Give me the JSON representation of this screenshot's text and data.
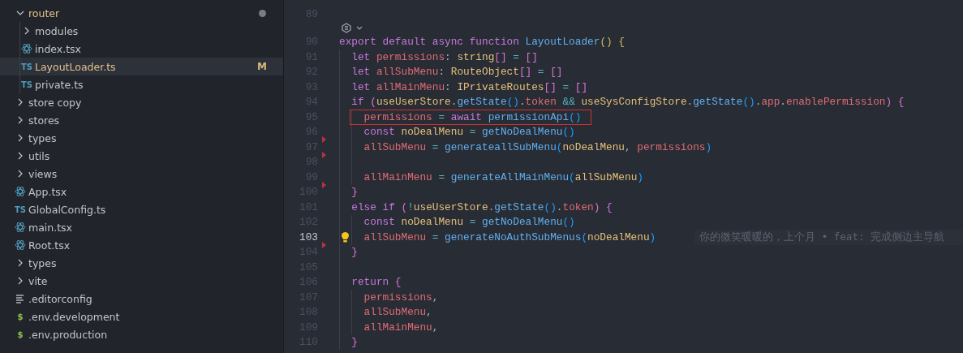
{
  "explorer": {
    "items": [
      {
        "kind": "cut-off",
        "children": [
          {
            "kind": "folder",
            "label": "router",
            "expanded": true,
            "modified": true,
            "selected": false,
            "children": [
              {
                "kind": "folder",
                "label": "modules",
                "expanded": false,
                "modified": false,
                "selected": false
              },
              {
                "kind": "react",
                "label": "index.tsx",
                "modified": false,
                "selected": false
              },
              {
                "kind": "ts",
                "icon": "TS",
                "label": "LayoutLoader.ts",
                "modified": true,
                "badge": "M",
                "selected": true
              },
              {
                "kind": "ts",
                "icon": "TS",
                "label": "private.ts",
                "modified": false,
                "selected": false
              }
            ]
          },
          {
            "kind": "folder",
            "label": "store copy",
            "expanded": false,
            "modified": false,
            "selected": false
          },
          {
            "kind": "folder",
            "label": "stores",
            "expanded": false,
            "modified": false,
            "selected": false
          },
          {
            "kind": "folder",
            "label": "types",
            "expanded": false,
            "modified": false,
            "selected": false
          },
          {
            "kind": "folder",
            "label": "utils",
            "expanded": false,
            "modified": false,
            "selected": false
          },
          {
            "kind": "folder",
            "label": "views",
            "expanded": false,
            "modified": false,
            "selected": false
          },
          {
            "kind": "react",
            "label": "App.tsx",
            "modified": false,
            "selected": false
          },
          {
            "kind": "ts",
            "icon": "TS",
            "label": "GlobalConfig.ts",
            "modified": false,
            "selected": false
          },
          {
            "kind": "react",
            "label": "main.tsx",
            "modified": false,
            "selected": false
          },
          {
            "kind": "react",
            "label": "Root.tsx",
            "modified": false,
            "selected": false
          }
        ]
      },
      {
        "kind": "folder",
        "label": "types",
        "expanded": false,
        "modified": false,
        "selected": false
      },
      {
        "kind": "folder",
        "label": "vite",
        "expanded": false,
        "modified": false,
        "selected": false
      },
      {
        "kind": "config",
        "label": ".editorconfig",
        "modified": false,
        "selected": false
      },
      {
        "kind": "env",
        "icon": "$",
        "label": ".env.development",
        "modified": false,
        "selected": false
      },
      {
        "kind": "env",
        "icon": "$",
        "label": ".env.production",
        "modified": false,
        "selected": false
      }
    ]
  },
  "editor": {
    "lines": [
      {
        "number": "89",
        "current": false
      },
      {
        "number": "90",
        "current": false,
        "code_lens": true,
        "tokens": [
          {
            "text": "export default async function ",
            "kind": "kw"
          },
          {
            "text": "LayoutLoader",
            "kind": "fn"
          },
          {
            "text": "() {",
            "kind": "b1"
          }
        ],
        "children": [
          {
            "number": "91",
            "current": false,
            "tokens": [
              {
                "text": "let ",
                "kind": "kw"
              },
              {
                "text": "permissions",
                "kind": "var"
              },
              {
                "text": ": ",
                "kind": "p"
              },
              {
                "text": "string",
                "kind": "ident"
              },
              {
                "text": "[]",
                "kind": "b2"
              },
              {
                "text": " = ",
                "kind": "op"
              },
              {
                "text": "[]",
                "kind": "b2"
              }
            ]
          },
          {
            "number": "92",
            "current": false,
            "tokens": [
              {
                "text": "let ",
                "kind": "kw"
              },
              {
                "text": "allSubMenu",
                "kind": "var"
              },
              {
                "text": ": ",
                "kind": "p"
              },
              {
                "text": "RouteObject",
                "kind": "ident"
              },
              {
                "text": "[]",
                "kind": "b2"
              },
              {
                "text": " = ",
                "kind": "op"
              },
              {
                "text": "[]",
                "kind": "b2"
              }
            ]
          },
          {
            "number": "93",
            "current": false,
            "tokens": [
              {
                "text": "let ",
                "kind": "kw"
              },
              {
                "text": "allMainMenu",
                "kind": "var"
              },
              {
                "text": ": ",
                "kind": "p"
              },
              {
                "text": "IPrivateRoutes",
                "kind": "ident"
              },
              {
                "text": "[]",
                "kind": "b2"
              },
              {
                "text": " = ",
                "kind": "op"
              },
              {
                "text": "[]",
                "kind": "b2"
              }
            ]
          },
          {
            "number": "94",
            "current": false,
            "tokens": [
              {
                "text": "if ",
                "kind": "kw"
              },
              {
                "text": "(",
                "kind": "b2"
              },
              {
                "text": "useUserStore",
                "kind": "ident"
              },
              {
                "text": ".",
                "kind": "p"
              },
              {
                "text": "getState",
                "kind": "fn"
              },
              {
                "text": "()",
                "kind": "b3"
              },
              {
                "text": ".",
                "kind": "p"
              },
              {
                "text": "token",
                "kind": "prop"
              },
              {
                "text": " && ",
                "kind": "op"
              },
              {
                "text": "useSysConfigStore",
                "kind": "ident"
              },
              {
                "text": ".",
                "kind": "p"
              },
              {
                "text": "getState",
                "kind": "fn"
              },
              {
                "text": "()",
                "kind": "b3"
              },
              {
                "text": ".",
                "kind": "p"
              },
              {
                "text": "app",
                "kind": "prop"
              },
              {
                "text": ".",
                "kind": "p"
              },
              {
                "text": "enablePermission",
                "kind": "prop"
              },
              {
                "text": ") {",
                "kind": "b2"
              }
            ],
            "children": [
              {
                "number": "95",
                "current": false,
                "highlighted": true,
                "tokens": [
                  {
                    "text": "permissions",
                    "kind": "var"
                  },
                  {
                    "text": " = ",
                    "kind": "op"
                  },
                  {
                    "text": "await ",
                    "kind": "kw"
                  },
                  {
                    "text": "permissionApi",
                    "kind": "fn"
                  },
                  {
                    "text": "()",
                    "kind": "b3"
                  }
                ]
              },
              {
                "number": "96",
                "current": false,
                "deleted_after": true,
                "tokens": [
                  {
                    "text": "const ",
                    "kind": "kw"
                  },
                  {
                    "text": "noDealMenu",
                    "kind": "ident"
                  },
                  {
                    "text": " = ",
                    "kind": "op"
                  },
                  {
                    "text": "getNoDealMenu",
                    "kind": "fn"
                  },
                  {
                    "text": "()",
                    "kind": "b3"
                  }
                ]
              },
              {
                "number": "97",
                "current": false,
                "deleted_after": true,
                "tokens": [
                  {
                    "text": "allSubMenu",
                    "kind": "var"
                  },
                  {
                    "text": " = ",
                    "kind": "op"
                  },
                  {
                    "text": "generateallSubMenu",
                    "kind": "fn"
                  },
                  {
                    "text": "(",
                    "kind": "b3"
                  },
                  {
                    "text": "noDealMenu",
                    "kind": "ident"
                  },
                  {
                    "text": ", ",
                    "kind": "p"
                  },
                  {
                    "text": "permissions",
                    "kind": "var"
                  },
                  {
                    "text": ")",
                    "kind": "b3"
                  }
                ]
              },
              {
                "number": "98",
                "current": false
              },
              {
                "number": "99",
                "current": false,
                "deleted_after": true,
                "tokens": [
                  {
                    "text": "allMainMenu",
                    "kind": "var"
                  },
                  {
                    "text": " = ",
                    "kind": "op"
                  },
                  {
                    "text": "generateAllMainMenu",
                    "kind": "fn"
                  },
                  {
                    "text": "(",
                    "kind": "b3"
                  },
                  {
                    "text": "allSubMenu",
                    "kind": "ident"
                  },
                  {
                    "text": ")",
                    "kind": "b3"
                  }
                ]
              }
            ]
          },
          {
            "number": "100",
            "current": false,
            "tokens": [
              {
                "text": "}",
                "kind": "b2"
              }
            ]
          },
          {
            "number": "101",
            "current": false,
            "tokens": [
              {
                "text": "else if ",
                "kind": "kw"
              },
              {
                "text": "(",
                "kind": "b2"
              },
              {
                "text": "!",
                "kind": "op"
              },
              {
                "text": "useUserStore",
                "kind": "ident"
              },
              {
                "text": ".",
                "kind": "p"
              },
              {
                "text": "getState",
                "kind": "fn"
              },
              {
                "text": "()",
                "kind": "b3"
              },
              {
                "text": ".",
                "kind": "p"
              },
              {
                "text": "token",
                "kind": "prop"
              },
              {
                "text": ") {",
                "kind": "b2"
              }
            ],
            "children": [
              {
                "number": "102",
                "current": false,
                "tokens": [
                  {
                    "text": "const ",
                    "kind": "kw"
                  },
                  {
                    "text": "noDealMenu",
                    "kind": "ident"
                  },
                  {
                    "text": " = ",
                    "kind": "op"
                  },
                  {
                    "text": "getNoDealMenu",
                    "kind": "fn"
                  },
                  {
                    "text": "()",
                    "kind": "b3"
                  }
                ]
              },
              {
                "number": "103",
                "current": true,
                "lightbulb": true,
                "deleted_after": true,
                "blame": "你的微笑暖暖的，上个月 • feat: 完成侧边主导航",
                "tokens": [
                  {
                    "text": "allSubMenu",
                    "kind": "var"
                  },
                  {
                    "text": " = ",
                    "kind": "op"
                  },
                  {
                    "text": "generateNoAuthSubMenus",
                    "kind": "fn"
                  },
                  {
                    "text": "(",
                    "kind": "b3"
                  },
                  {
                    "text": "noDealMenu",
                    "kind": "ident"
                  },
                  {
                    "text": ")",
                    "kind": "b3"
                  }
                ]
              }
            ]
          },
          {
            "number": "104",
            "current": false,
            "tokens": [
              {
                "text": "}",
                "kind": "b2"
              }
            ]
          },
          {
            "number": "105",
            "current": false
          },
          {
            "number": "106",
            "current": false,
            "tokens": [
              {
                "text": "return ",
                "kind": "kw"
              },
              {
                "text": "{",
                "kind": "b2"
              }
            ],
            "children": [
              {
                "number": "107",
                "current": false,
                "tokens": [
                  {
                    "text": "permissions",
                    "kind": "var"
                  },
                  {
                    "text": ",",
                    "kind": "p"
                  }
                ]
              },
              {
                "number": "108",
                "current": false,
                "tokens": [
                  {
                    "text": "allSubMenu",
                    "kind": "var"
                  },
                  {
                    "text": ",",
                    "kind": "p"
                  }
                ]
              },
              {
                "number": "109",
                "current": false,
                "tokens": [
                  {
                    "text": "allMainMenu",
                    "kind": "var"
                  },
                  {
                    "text": ",",
                    "kind": "p"
                  }
                ]
              }
            ]
          },
          {
            "number": "110",
            "current": false,
            "tokens": [
              {
                "text": "}",
                "kind": "b2"
              }
            ]
          }
        ]
      }
    ]
  }
}
